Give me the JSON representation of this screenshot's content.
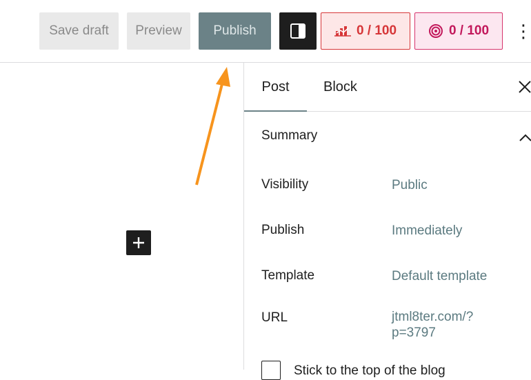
{
  "toolbar": {
    "save_draft_label": "Save draft",
    "preview_label": "Preview",
    "publish_label": "Publish",
    "settings_icon": "sidebar-toggle-icon",
    "seo_score": "0 / 100",
    "seo_icon": "seo-chart-icon",
    "readability_score": "0 / 100",
    "readability_icon": "readability-icon",
    "more_label": "⋮"
  },
  "editor": {
    "add_block_icon": "plus-icon"
  },
  "annotation": {
    "arrow_color": "#f7941d"
  },
  "sidebar": {
    "tabs": [
      {
        "label": "Post",
        "active": true
      },
      {
        "label": "Block",
        "active": false
      }
    ],
    "close_icon": "close-icon",
    "summary_title": "Summary",
    "rows": [
      {
        "label": "Visibility",
        "value": "Public"
      },
      {
        "label": "Publish",
        "value": "Immediately"
      },
      {
        "label": "Template",
        "value": "Default template"
      },
      {
        "label": "URL",
        "value": "jtml8ter.com/?p=3797"
      }
    ],
    "sticky_label": "Stick to the top of the blog"
  },
  "colors": {
    "publish_bg": "#6b8287",
    "seo_accent": "#d63638",
    "readability_accent": "#c2185b",
    "value_link": "#5b7a80"
  }
}
